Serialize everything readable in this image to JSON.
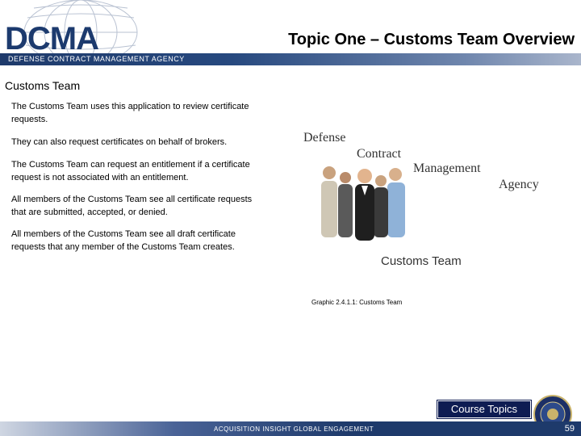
{
  "header": {
    "logo_text": "DCMA",
    "agency_name": "DEFENSE CONTRACT MANAGEMENT AGENCY",
    "page_title": "Topic One – Customs Team Overview"
  },
  "content": {
    "section_title": "Customs Team",
    "paragraphs": [
      "The Customs Team uses this application to review certificate requests.",
      "They can also request certificates on behalf of brokers.",
      "The Customs Team can request an entitlement if a certificate request is not associated with an entitlement.",
      "All members of the Customs Team see all certificate requests that are submitted, accepted, or denied.",
      "All members of the Customs Team see all draft certificate requests that any member of the Customs Team creates."
    ]
  },
  "graphic": {
    "words": [
      "Defense",
      "Contract",
      "Management",
      "Agency"
    ],
    "label": "Customs Team",
    "caption": "Graphic 2.4.1.1: Customs Team"
  },
  "footer": {
    "course_topics_label": "Course Topics",
    "tagline": "ACQUISITION INSIGHT GLOBAL ENGAGEMENT",
    "page_number": "59"
  },
  "colors": {
    "brand_navy": "#1c3a6e",
    "button_navy": "#0e1c52"
  }
}
